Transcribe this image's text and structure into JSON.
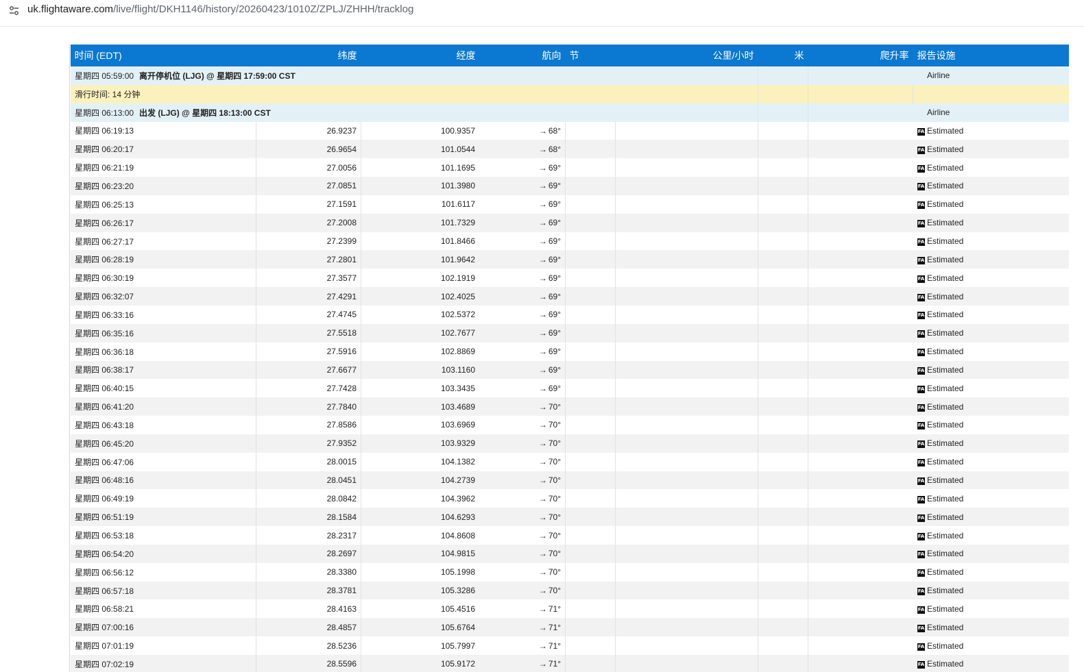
{
  "browser": {
    "url_host": "uk.flightaware.com",
    "url_path": "/live/flight/DKH1146/history/20260423/1010Z/ZPLJ/ZHHH/tracklog",
    "site_icon": "tune-settings-icon"
  },
  "table": {
    "headers": {
      "time": "时间 (EDT)",
      "lat": "纬度",
      "lon": "经度",
      "heading": "航向",
      "knots": "节",
      "kmh": "公里/小时",
      "meters": "米",
      "climb": "爬升率",
      "facility": "报告设施"
    },
    "events": [
      {
        "time": "星期四 05:59:00",
        "label": "离开停机位 (LJG) @ 星期四 17:59:00 CST",
        "facility": "Airline"
      },
      {
        "label": "滑行时间: 14 分钟"
      },
      {
        "time": "星期四 06:13:00",
        "label": "出发 (LJG) @ 星期四 18:13:00 CST",
        "facility": "Airline"
      }
    ],
    "estimated_label": "Estimated",
    "fa_badge": "FA",
    "arrow_glyph": "→",
    "rows": [
      {
        "time": "星期四 06:19:13",
        "lat": "26.9237",
        "lon": "100.9357",
        "heading": "68°"
      },
      {
        "time": "星期四 06:20:17",
        "lat": "26.9654",
        "lon": "101.0544",
        "heading": "68°"
      },
      {
        "time": "星期四 06:21:19",
        "lat": "27.0056",
        "lon": "101.1695",
        "heading": "69°"
      },
      {
        "time": "星期四 06:23:20",
        "lat": "27.0851",
        "lon": "101.3980",
        "heading": "69°"
      },
      {
        "time": "星期四 06:25:13",
        "lat": "27.1591",
        "lon": "101.6117",
        "heading": "69°"
      },
      {
        "time": "星期四 06:26:17",
        "lat": "27.2008",
        "lon": "101.7329",
        "heading": "69°"
      },
      {
        "time": "星期四 06:27:17",
        "lat": "27.2399",
        "lon": "101.8466",
        "heading": "69°"
      },
      {
        "time": "星期四 06:28:19",
        "lat": "27.2801",
        "lon": "101.9642",
        "heading": "69°"
      },
      {
        "time": "星期四 06:30:19",
        "lat": "27.3577",
        "lon": "102.1919",
        "heading": "69°"
      },
      {
        "time": "星期四 06:32:07",
        "lat": "27.4291",
        "lon": "102.4025",
        "heading": "69°"
      },
      {
        "time": "星期四 06:33:16",
        "lat": "27.4745",
        "lon": "102.5372",
        "heading": "69°"
      },
      {
        "time": "星期四 06:35:16",
        "lat": "27.5518",
        "lon": "102.7677",
        "heading": "69°"
      },
      {
        "time": "星期四 06:36:18",
        "lat": "27.5916",
        "lon": "102.8869",
        "heading": "69°"
      },
      {
        "time": "星期四 06:38:17",
        "lat": "27.6677",
        "lon": "103.1160",
        "heading": "69°"
      },
      {
        "time": "星期四 06:40:15",
        "lat": "27.7428",
        "lon": "103.3435",
        "heading": "69°"
      },
      {
        "time": "星期四 06:41:20",
        "lat": "27.7840",
        "lon": "103.4689",
        "heading": "70°"
      },
      {
        "time": "星期四 06:43:18",
        "lat": "27.8586",
        "lon": "103.6969",
        "heading": "70°"
      },
      {
        "time": "星期四 06:45:20",
        "lat": "27.9352",
        "lon": "103.9329",
        "heading": "70°"
      },
      {
        "time": "星期四 06:47:06",
        "lat": "28.0015",
        "lon": "104.1382",
        "heading": "70°"
      },
      {
        "time": "星期四 06:48:16",
        "lat": "28.0451",
        "lon": "104.2739",
        "heading": "70°"
      },
      {
        "time": "星期四 06:49:19",
        "lat": "28.0842",
        "lon": "104.3962",
        "heading": "70°"
      },
      {
        "time": "星期四 06:51:19",
        "lat": "28.1584",
        "lon": "104.6293",
        "heading": "70°"
      },
      {
        "time": "星期四 06:53:18",
        "lat": "28.2317",
        "lon": "104.8608",
        "heading": "70°"
      },
      {
        "time": "星期四 06:54:20",
        "lat": "28.2697",
        "lon": "104.9815",
        "heading": "70°"
      },
      {
        "time": "星期四 06:56:12",
        "lat": "28.3380",
        "lon": "105.1998",
        "heading": "70°"
      },
      {
        "time": "星期四 06:57:18",
        "lat": "28.3781",
        "lon": "105.3286",
        "heading": "70°"
      },
      {
        "time": "星期四 06:58:21",
        "lat": "28.4163",
        "lon": "105.4516",
        "heading": "71°"
      },
      {
        "time": "星期四 07:00:16",
        "lat": "28.4857",
        "lon": "105.6764",
        "heading": "71°"
      },
      {
        "time": "星期四 07:01:19",
        "lat": "28.5236",
        "lon": "105.7997",
        "heading": "71°"
      },
      {
        "time": "星期四 07:02:19",
        "lat": "28.5596",
        "lon": "105.9172",
        "heading": "71°"
      }
    ]
  },
  "colors": {
    "header_bg": "#0b78d1",
    "event_blue": "#e3f1f7",
    "event_yellow": "#fbf1bd",
    "row_alt": "#f2f2f2"
  }
}
